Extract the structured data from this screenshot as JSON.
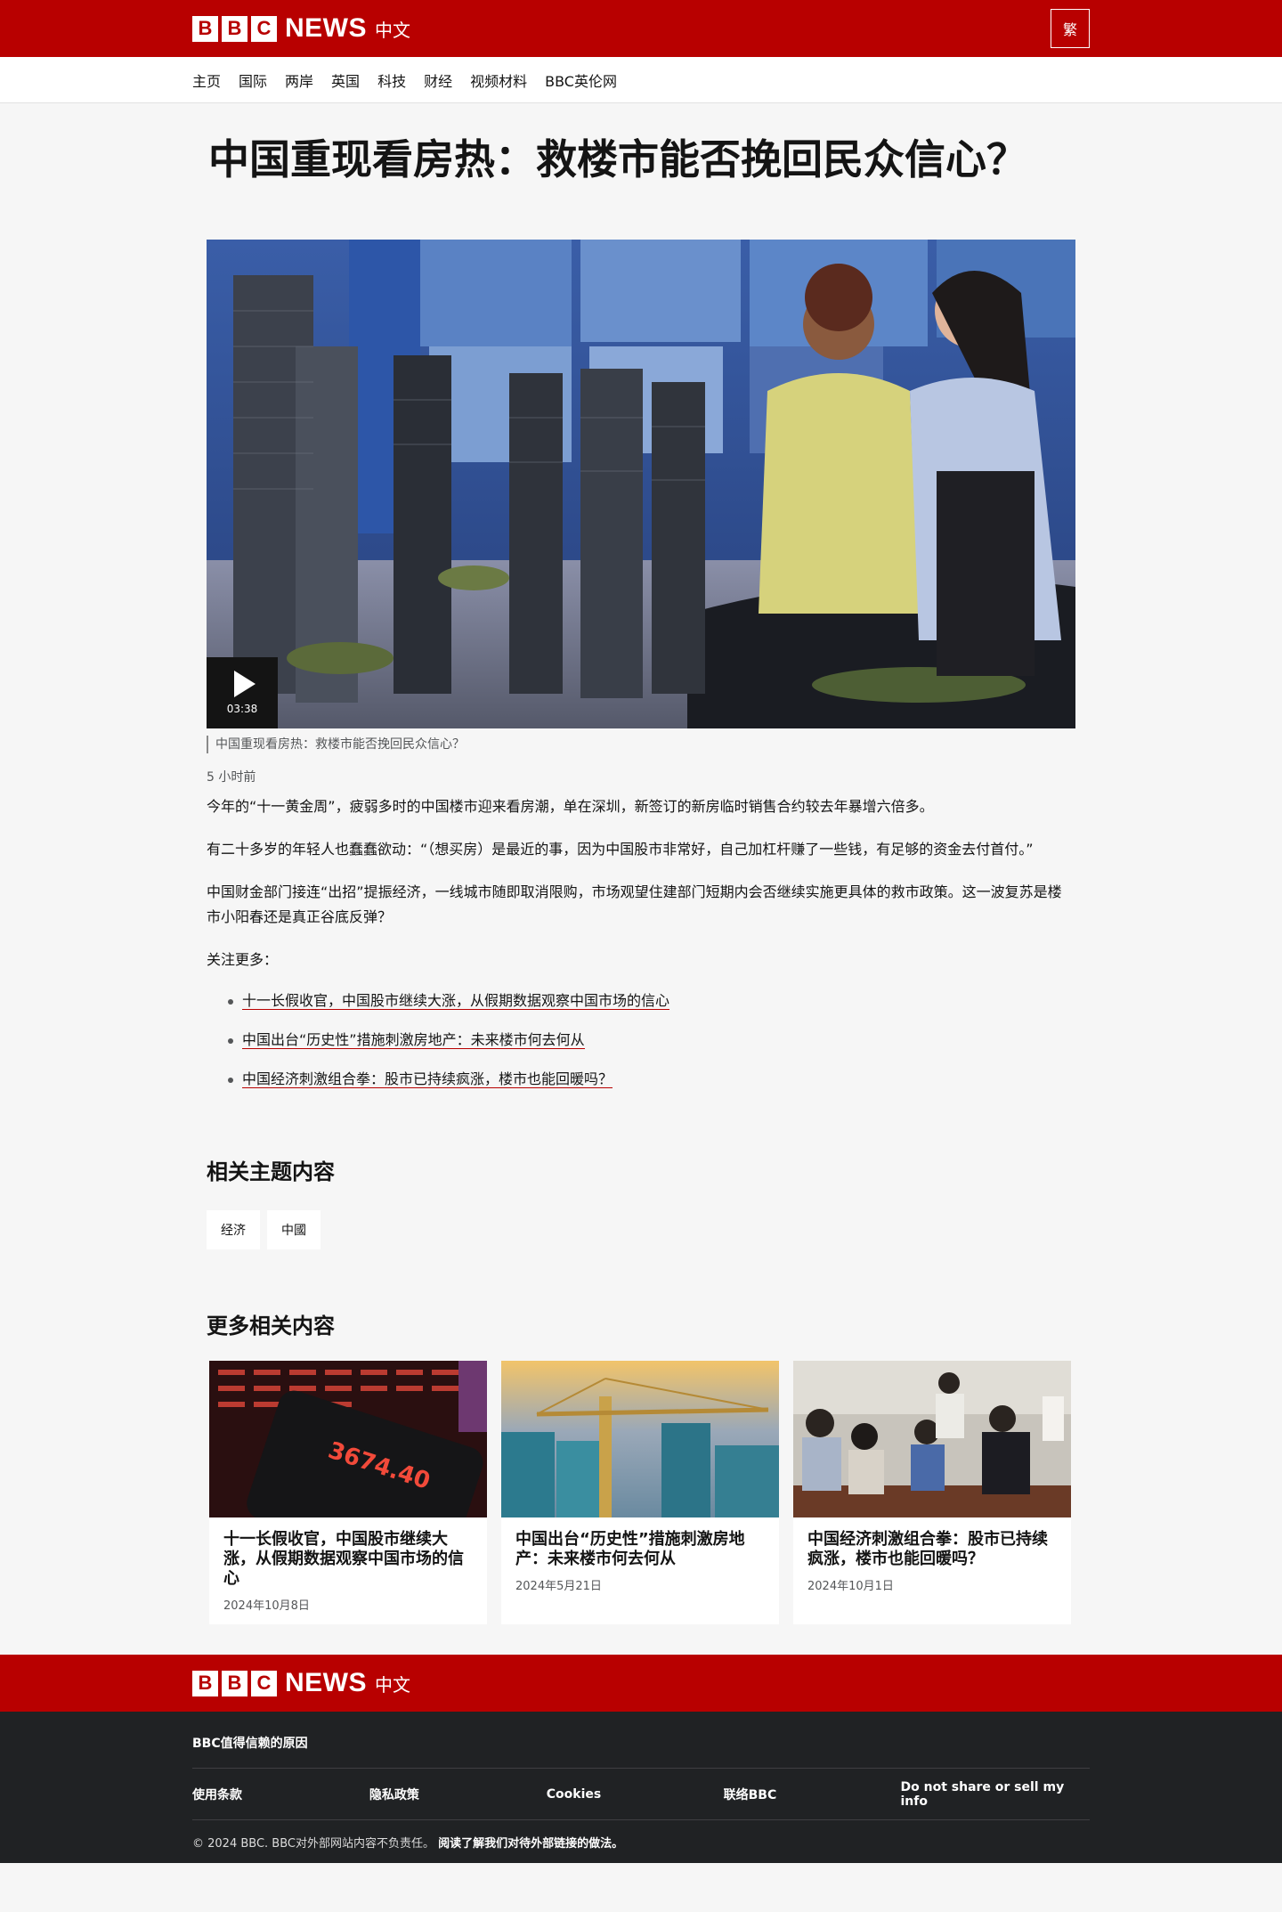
{
  "header": {
    "bbc_letters": [
      "B",
      "B",
      "C"
    ],
    "news_label": "NEWS",
    "service_label": "中文",
    "lang_toggle": "繁"
  },
  "nav": {
    "items": [
      "主页",
      "国际",
      "两岸",
      "英国",
      "科技",
      "财经",
      "视频材料",
      "BBC英伦网"
    ]
  },
  "article": {
    "headline": "中国重现看房热：救楼市能否挽回民众信心？",
    "video_duration": "03:38",
    "caption": "中国重现看房热：救楼市能否挽回民众信心？",
    "timestamp": "5 小时前",
    "paragraphs": [
      "今年的“十一黄金周”，疲弱多时的中国楼市迎来看房潮，单在深圳，新签订的新房临时销售合约较去年暴增六倍多。",
      "有二十多岁的年轻人也蠢蠢欲动：“（想买房）是最近的事，因为中国股市非常好，自己加杠杆赚了一些钱，有足够的资金去付首付。”",
      "中国财金部门接连“出招”提振经济，一线城市随即取消限购，市场观望住建部门短期内会否继续实施更具体的救市政策。这一波复苏是楼市小阳春还是真正谷底反弹？",
      "关注更多："
    ],
    "links": [
      "十一长假收官，中国股市继续大涨，从假期数据观察中国市场的信心",
      "中国出台“历史性”措施刺激房地产：未来楼市何去何从",
      "中国经济刺激组合拳：股市已持续疯涨，楼市也能回暖吗？"
    ]
  },
  "topics": {
    "title": "相关主题内容",
    "tags": [
      "经济",
      "中國"
    ]
  },
  "related": {
    "title": "更多相关内容",
    "cards": [
      {
        "title": "十一长假收官，中国股市继续大涨，从假期数据观察中国市场的信心",
        "date": "2024年10月8日",
        "image_text": "3674.40"
      },
      {
        "title": "中国出台“历史性”措施刺激房地产：未来楼市何去何从",
        "date": "2024年5月21日"
      },
      {
        "title": "中国经济刺激组合拳：股市已持续疯涨，楼市也能回暖吗？",
        "date": "2024年10月1日"
      }
    ]
  },
  "footer": {
    "trust_link": "BBC值得信赖的原因",
    "links": [
      "使用条款",
      "隐私政策",
      "Cookies",
      "联络BBC",
      "Do not share or sell my info"
    ],
    "copyright": "© 2024 BBC. BBC对外部网站内容不负责任。",
    "external_policy": "阅读了解我们对待外部链接的做法。"
  },
  "colors": {
    "brand_red": "#b80000",
    "footer_dark": "#202224",
    "page_bg": "#f6f6f6"
  }
}
